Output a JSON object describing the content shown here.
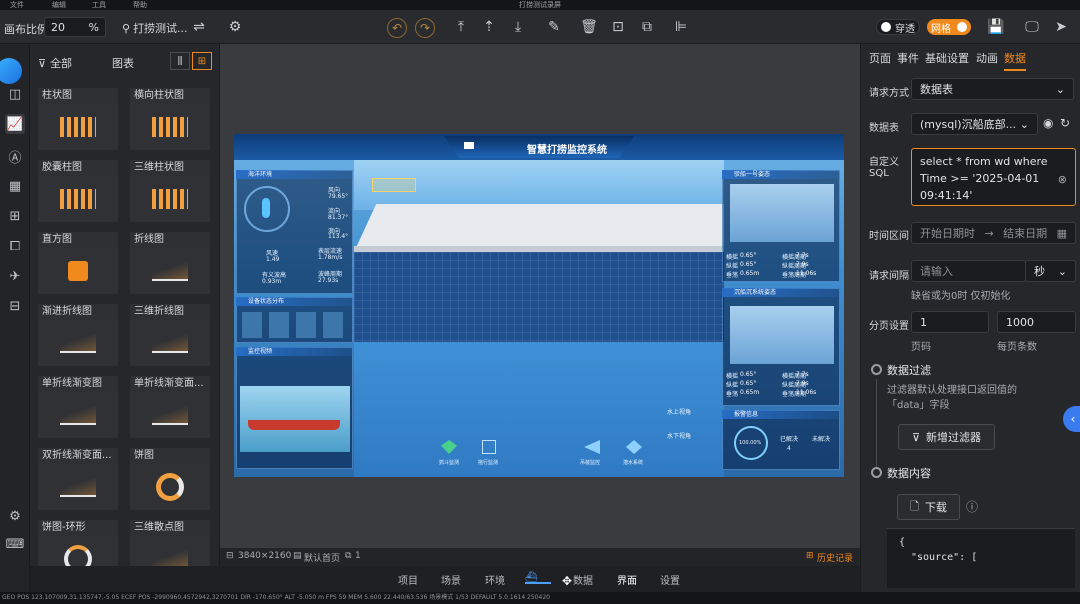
{
  "titlebar": {
    "menus": [
      "文件",
      "编辑",
      "工具",
      "帮助"
    ],
    "title": "打捞测试录屏"
  },
  "toolbar": {
    "canvas_ratio_label": "画布比例",
    "canvas_ratio_value": "20",
    "canvas_ratio_unit": "%",
    "project_name": "打捞测试...",
    "toggle_through": "穿透",
    "toggle_grid": "网格"
  },
  "component_panel": {
    "filter_label": "全部",
    "category_label": "图表",
    "cards": [
      {
        "label": "柱状图",
        "icon": "bar-chart-icon"
      },
      {
        "label": "横向柱状图",
        "icon": "horizontal-bar-icon"
      },
      {
        "label": "胶囊柱图",
        "icon": "capsule-bar-icon"
      },
      {
        "label": "三维柱状图",
        "icon": "3d-bar-icon"
      },
      {
        "label": "直方图",
        "icon": "histogram-icon"
      },
      {
        "label": "折线图",
        "icon": "line-chart-icon"
      },
      {
        "label": "渐进折线图",
        "icon": "gradient-line-icon"
      },
      {
        "label": "三维折线图",
        "icon": "3d-line-icon"
      },
      {
        "label": "单折线渐变图",
        "icon": "single-gradient-line-icon"
      },
      {
        "label": "单折线渐变面...",
        "icon": "single-gradient-area-icon"
      },
      {
        "label": "双折线渐变面...",
        "icon": "double-gradient-area-icon"
      },
      {
        "label": "饼图",
        "icon": "pie-chart-icon"
      },
      {
        "label": "饼图-环形",
        "icon": "donut-chart-icon"
      },
      {
        "label": "三维散点图",
        "icon": "3d-scatter-icon"
      }
    ]
  },
  "dashboard": {
    "title": "智慧打捞监控系统",
    "left": {
      "env_title": "海洋环境",
      "values": [
        "79.65°",
        "81.37°",
        "113.4°",
        "1.49",
        "1.78m/s",
        "0.93m",
        "27.93s"
      ],
      "small_labels": [
        "风向",
        "流向",
        "浪向",
        "风速",
        "表层流速",
        "有义波高",
        "波峰周期"
      ],
      "device_title": "设备状态分布",
      "monitor_title": "监控视频"
    },
    "right": {
      "ship1_title": "驳船一号姿态",
      "ship1_values": [
        "0.65°",
        "7.7s",
        "0.65°",
        "7.9s",
        "0.65m",
        "11.06s"
      ],
      "ship1_labels": [
        "横摇",
        "横摇周期",
        "纵摇",
        "纵摇周期",
        "垂荡",
        "垂荡周期"
      ],
      "ship2_title": "沉船沉系统姿态",
      "ship2_values": [
        "0.65°",
        "7.7s",
        "0.65°",
        "7.9s",
        "0.65m",
        "11.06s"
      ],
      "alarm_title": "报警信息",
      "alarm_ring": "100.00%",
      "alarm_handled": "已解决",
      "alarm_handled_count": "4",
      "alarm_unhandled": "未解决"
    },
    "view_above": "水上视角",
    "view_below": "水下视角",
    "bottom_icons": [
      "抓斗监测",
      "拖行监测",
      "吊装监控",
      "潜水系统"
    ]
  },
  "canvas_bar": {
    "resolution": "3840×2160",
    "default_page": "默认首页",
    "page_count": "1",
    "history": "历史记录"
  },
  "bottom_nav": [
    "项目",
    "场景",
    "环境",
    "数据",
    "界面",
    "设置"
  ],
  "statusbar": "GEO POS 123.107009,31.135747,-5.05    ECEF POS -2990960,4572942,3270701  DIR -170.650°  ALT -5.050 m   FPS 59   MEM 5.600 22.440/63.536                                                    场景模式  1/53     DEFAULT  5.0.1614 250420",
  "right_panel": {
    "tabs": [
      "页面",
      "事件",
      "基础设置",
      "动画",
      "数据"
    ],
    "request_method_label": "请求方式",
    "request_method_value": "数据表",
    "datatable_label": "数据表",
    "datatable_value": "(mysql)沉船底部...",
    "custom_sql_label_1": "自定义",
    "custom_sql_label_2": "SQL",
    "custom_sql_value": "select * from wd where Time >= '2025-04-01 09:41:14'",
    "time_range_label": "时间区间",
    "start_date_placeholder": "开始日期时",
    "end_date_placeholder": "结束日期",
    "interval_label": "请求间隔",
    "interval_placeholder": "请输入",
    "interval_unit": "秒",
    "interval_hint": "缺省或为0时 仅初始化",
    "paging_label": "分页设置",
    "page_value": "1",
    "page_size_value": "1000",
    "page_label": "页码",
    "page_size_label": "每页条数",
    "filter_title": "数据过滤",
    "filter_desc_1": "过滤器默认处理接口返回值的",
    "filter_desc_2": "「data」字段",
    "add_filter_button": "新增过滤器",
    "content_title": "数据内容",
    "download_button": "下载",
    "json_line_1": "{",
    "json_line_2": "\"source\": ["
  }
}
